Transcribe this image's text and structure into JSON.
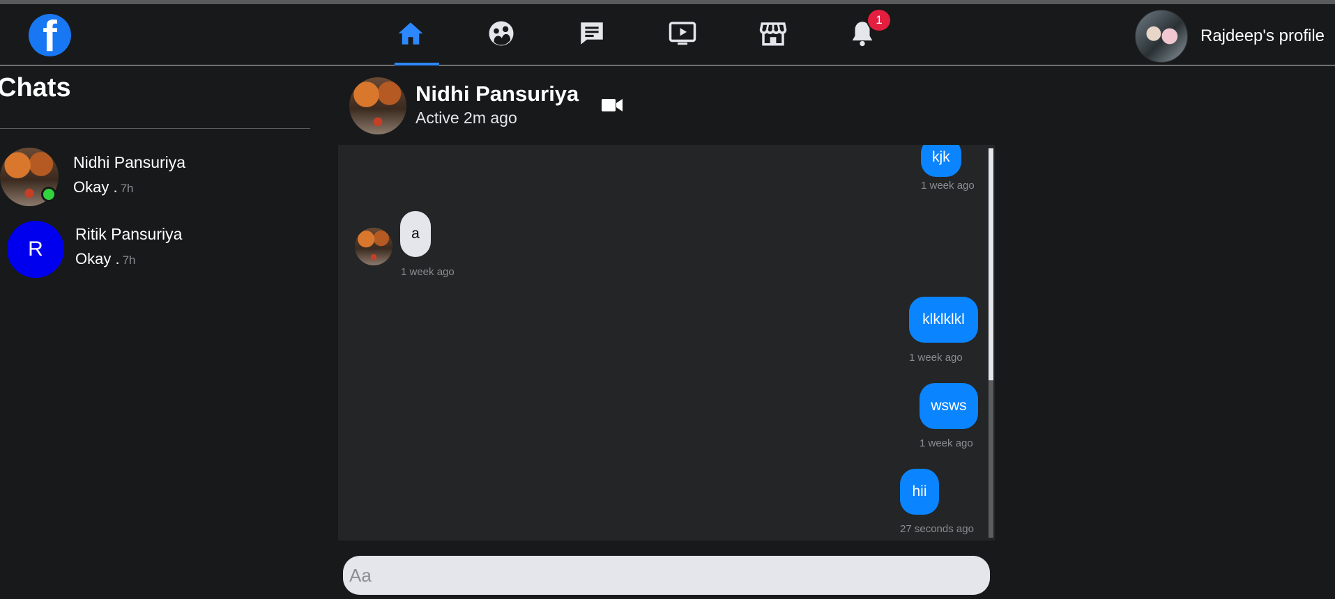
{
  "nav": {
    "logo": "f",
    "icons": [
      "home-icon",
      "groups-icon",
      "messages-icon",
      "watch-icon",
      "marketplace-icon",
      "notifications-icon"
    ],
    "active_icon": "home-icon",
    "notification_count": "1",
    "profile_name": "Rajdeep's profile",
    "accent_color": "#2d88ff"
  },
  "sidebar": {
    "title": "Chats",
    "items": [
      {
        "name": "Nidhi Pansuriya",
        "preview": "Okay .",
        "time": "7h",
        "avatar": "photo",
        "online": true
      },
      {
        "name": "Ritik Pansuriya",
        "preview": "Okay .",
        "time": "7h",
        "avatar_letter": "R",
        "avatar_color": "#0000ee",
        "online": false
      }
    ]
  },
  "chat": {
    "name": "Nidhi Pansuriya",
    "status": "Active 2m ago",
    "messages": [
      {
        "text": "kjk",
        "time": "1 week ago",
        "from": "me"
      },
      {
        "text": "a",
        "time": "1 week ago",
        "from": "them"
      },
      {
        "text": "klklklkl",
        "time": "1 week ago",
        "from": "me"
      },
      {
        "text": "wsws",
        "time": "1 week ago",
        "from": "me"
      },
      {
        "text": "hii",
        "time": "27 seconds ago",
        "from": "me"
      }
    ],
    "composer_placeholder": "Aa",
    "outgoing_color": "#0a84ff",
    "incoming_color": "#e4e6eb"
  }
}
